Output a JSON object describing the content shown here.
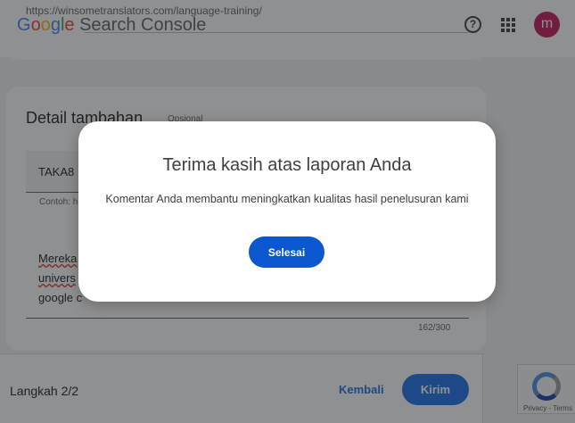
{
  "header": {
    "url": "https://winsometranslators.com/language-training/",
    "logo_google": [
      "G",
      "o",
      "o",
      "g",
      "l",
      "e"
    ],
    "logo_product": "Search Console",
    "avatar_letter": "m"
  },
  "detail": {
    "title": "Detail tambahan",
    "optional": "Opsional",
    "field1_value": "TAKA8",
    "field1_hint": "Contoh: h",
    "field2_line1": "Mereka",
    "field2_line2": "univers",
    "field2_line3": "google c",
    "counter": "162/300"
  },
  "footer": {
    "step": "Langkah 2/2",
    "back": "Kembali",
    "send": "Kirim"
  },
  "recaptcha": {
    "text": "Privacy - Terms"
  },
  "dialog": {
    "title": "Terima kasih atas laporan Anda",
    "body": "Komentar Anda membantu meningkatkan kualitas hasil penelusuran kami",
    "done": "Selesai"
  },
  "colors": {
    "accent": "#1a73e8",
    "dialog_button": "#0b57d0",
    "avatar": "#c2185b"
  }
}
